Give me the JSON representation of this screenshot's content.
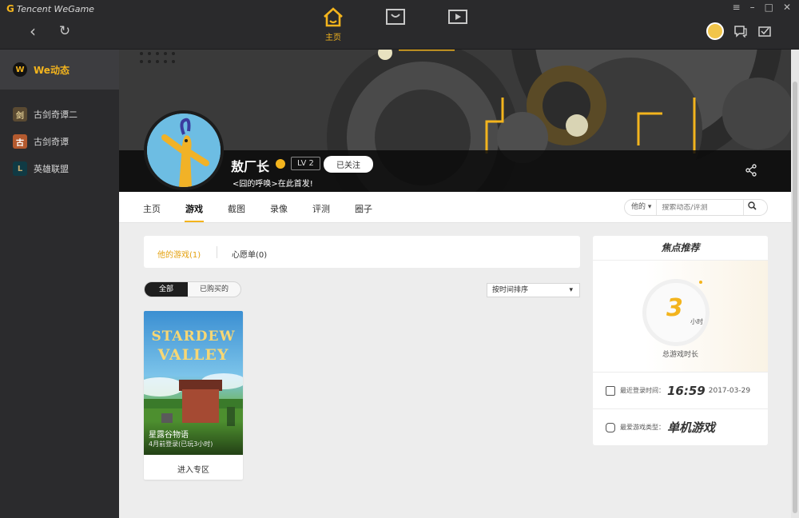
{
  "app": {
    "brand_g": "G",
    "brand": "Tencent WeGame"
  },
  "window_controls": {
    "menu": "≡",
    "minimize": "–",
    "maximize": "□",
    "close": "✕"
  },
  "nav": {
    "back": "‹",
    "refresh": "↻"
  },
  "top_tabs": [
    {
      "label": "主页"
    }
  ],
  "sidebar": {
    "items": [
      {
        "label": "We动态",
        "icon_text": "W"
      },
      {
        "label": "古剑奇谭二",
        "icon_text": "剑"
      },
      {
        "label": "古剑奇谭",
        "icon_text": "古"
      },
      {
        "label": "英雄联盟",
        "icon_text": "L"
      }
    ]
  },
  "profile": {
    "name": "敖厂长",
    "level": "LV 2",
    "follow_label": "已关注",
    "slogan": "<囧的呼唤>在此首发!"
  },
  "subnav": {
    "tabs": [
      "主页",
      "游戏",
      "截图",
      "录像",
      "评测",
      "圈子"
    ],
    "active": "游戏",
    "search_scope": "他的 ▾",
    "search_placeholder": "搜索动态/评测"
  },
  "game_tabs": {
    "mine": "他的游戏(1)",
    "wishlist": "心愿单(0)"
  },
  "filters": {
    "all": "全部",
    "purchased": "已购买的",
    "sort": "按时间排序"
  },
  "games": [
    {
      "cover_line1": "STARDEW",
      "cover_line2": "VALLEY",
      "name": "星露谷物语",
      "status": "4月前登录(已玩3小时)",
      "enter_label": "进入专区"
    }
  ],
  "focus": {
    "title": "焦点推荐",
    "hours": "3",
    "hours_unit": "小时",
    "hours_label": "总游戏时长",
    "last_login_label": "最近登录时间：",
    "last_login_time": "16:59",
    "last_login_date": "2017-03-29",
    "fav_type_label": "最爱游戏类型：",
    "fav_type": "单机游戏"
  },
  "colors": {
    "accent": "#f3b41d",
    "titlebar": "#2a2a2c",
    "sidebar_active": "#3d3d40"
  }
}
